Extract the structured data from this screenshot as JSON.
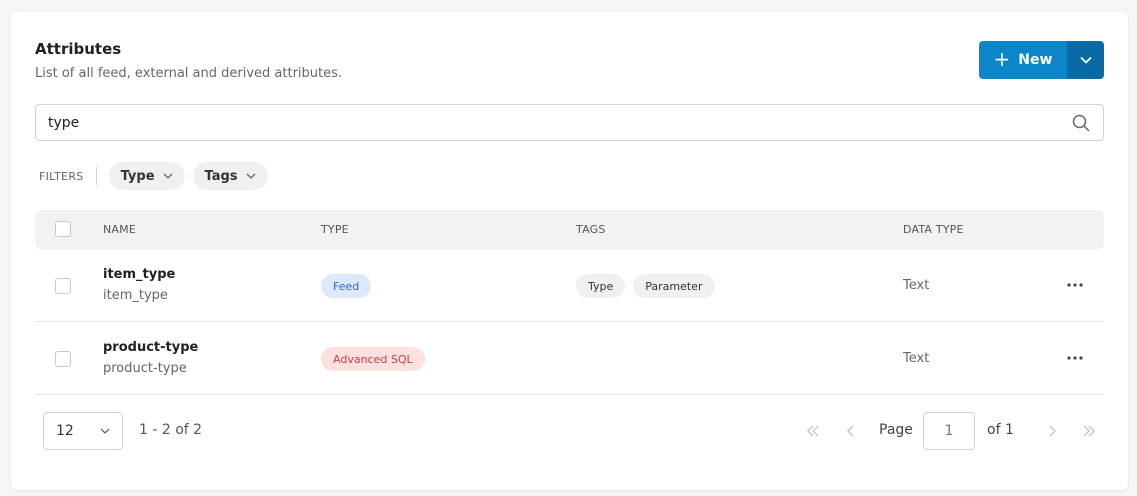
{
  "header": {
    "title": "Attributes",
    "subtitle": "List of all feed, external and derived attributes."
  },
  "new_button": {
    "plus": "+",
    "label": "New"
  },
  "search": {
    "value": "type",
    "icon": "search-icon"
  },
  "filters": {
    "label": "FILTERS",
    "chips": [
      {
        "label": "Type"
      },
      {
        "label": "Tags"
      }
    ]
  },
  "table": {
    "columns": {
      "name": "NAME",
      "type": "TYPE",
      "tags": "TAGS",
      "data_type": "DATA TYPE"
    },
    "rows": [
      {
        "name": "item_type",
        "sub": "item_type",
        "type": "Feed",
        "tags": [
          "Type",
          "Parameter"
        ],
        "data_type": "Text"
      },
      {
        "name": "product-type",
        "sub": "product-type",
        "type": "Advanced SQL",
        "tags": [],
        "data_type": "Text"
      }
    ]
  },
  "pagination": {
    "page_size": "12",
    "range": "1 - 2 of 2",
    "page_label": "Page",
    "page_value": "1",
    "of_label": "of 1"
  },
  "colors": {
    "primary": "#0b87c9",
    "primary_dark": "#0a6aa3",
    "feed_badge_bg": "#dde9fb",
    "feed_badge_text": "#2b6cc4",
    "sql_badge_bg": "#fde0e0",
    "sql_badge_text": "#d23c3c"
  }
}
